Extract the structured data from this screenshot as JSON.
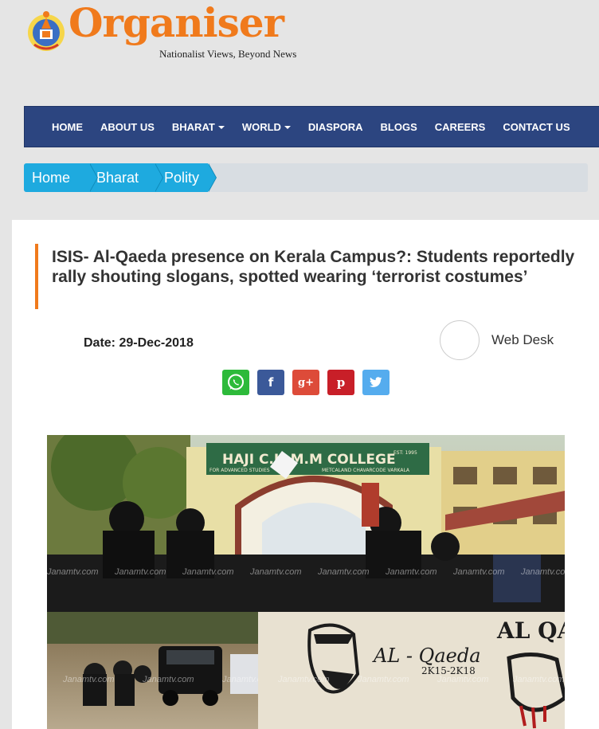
{
  "site": {
    "name": "Organiser",
    "tagline": "Nationalist Views, Beyond News"
  },
  "nav": {
    "items": [
      {
        "label": "HOME",
        "dropdown": false
      },
      {
        "label": "ABOUT US",
        "dropdown": false
      },
      {
        "label": "BHARAT",
        "dropdown": true
      },
      {
        "label": "WORLD",
        "dropdown": true
      },
      {
        "label": "DIASPORA",
        "dropdown": false
      },
      {
        "label": "BLOGS",
        "dropdown": false
      },
      {
        "label": "CAREERS",
        "dropdown": false
      },
      {
        "label": "CONTACT US",
        "dropdown": false
      }
    ]
  },
  "breadcrumb": [
    "Home",
    "Bharat",
    "Polity"
  ],
  "article": {
    "title": "ISIS- Al-Qaeda presence on Kerala Campus?: Students reportedly rally shouting slogans, spotted wearing ‘terrorist costumes’",
    "date": "Date: 29-Dec-2018",
    "author": "Web Desk",
    "share_icons": [
      "whatsapp-icon",
      "facebook-icon",
      "google-plus-icon",
      "pinterest-icon",
      "twitter-icon"
    ],
    "share_glyphs": {
      "facebook": "f",
      "google_plus": "g+",
      "pinterest": "p"
    }
  },
  "photo": {
    "college_sign": "HAJI C.H.M.M COLLEGE",
    "college_sub": "FOR ADVANCED STUDIES",
    "college_place": "METCALAND CHAVARCODE VARKALA",
    "college_est": "EST: 1995",
    "wall_text_1": "AL - Qaeda",
    "wall_text_2": "2K15-2K18",
    "wall_text_3": "AL QA",
    "watermark": "Janamtv.com"
  },
  "colors": {
    "brand_orange": "#f07a1c",
    "nav_bg": "#2c4580",
    "breadcrumb_blue": "#1eaadf"
  }
}
